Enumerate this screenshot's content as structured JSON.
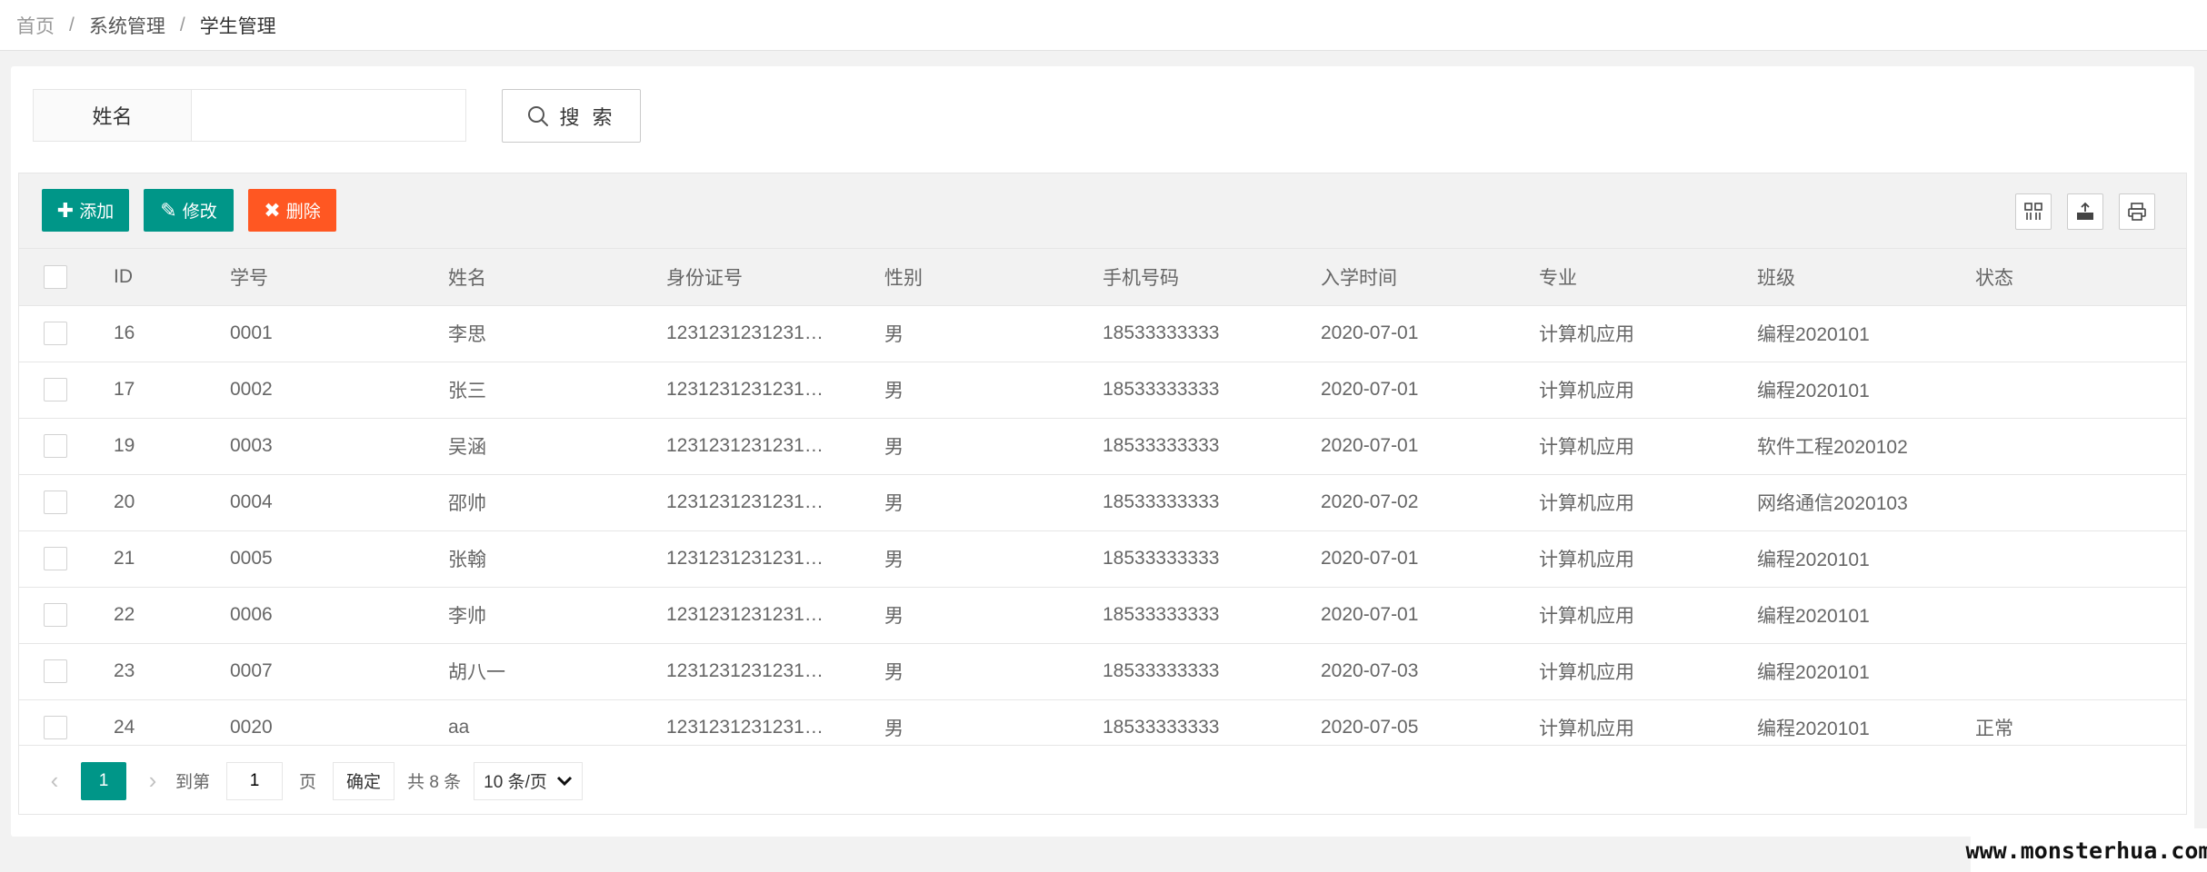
{
  "breadcrumb": {
    "home": "首页",
    "system": "系统管理",
    "current": "学生管理",
    "separator": "/"
  },
  "search": {
    "label": "姓名",
    "value": "",
    "placeholder": "",
    "button_label": "搜 索"
  },
  "toolbar": {
    "add_label": "添加",
    "edit_label": "修改",
    "delete_label": "删除"
  },
  "colors": {
    "primary": "#009688",
    "danger": "#ff5722"
  },
  "table": {
    "headers": [
      "ID",
      "学号",
      "姓名",
      "身份证号",
      "性别",
      "手机号码",
      "入学时间",
      "专业",
      "班级",
      "状态"
    ],
    "rows": [
      [
        "16",
        "0001",
        "李思",
        "1231231231231…",
        "男",
        "18533333333",
        "2020-07-01",
        "计算机应用",
        "编程2020101",
        ""
      ],
      [
        "17",
        "0002",
        "张三",
        "1231231231231…",
        "男",
        "18533333333",
        "2020-07-01",
        "计算机应用",
        "编程2020101",
        ""
      ],
      [
        "19",
        "0003",
        "吴涵",
        "1231231231231…",
        "男",
        "18533333333",
        "2020-07-01",
        "计算机应用",
        "软件工程2020102",
        ""
      ],
      [
        "20",
        "0004",
        "邵帅",
        "1231231231231…",
        "男",
        "18533333333",
        "2020-07-02",
        "计算机应用",
        "网络通信2020103",
        ""
      ],
      [
        "21",
        "0005",
        "张翰",
        "1231231231231…",
        "男",
        "18533333333",
        "2020-07-01",
        "计算机应用",
        "编程2020101",
        ""
      ],
      [
        "22",
        "0006",
        "李帅",
        "1231231231231…",
        "男",
        "18533333333",
        "2020-07-01",
        "计算机应用",
        "编程2020101",
        ""
      ],
      [
        "23",
        "0007",
        "胡八一",
        "1231231231231…",
        "男",
        "18533333333",
        "2020-07-03",
        "计算机应用",
        "编程2020101",
        ""
      ],
      [
        "24",
        "0020",
        "aa",
        "1231231231231…",
        "男",
        "18533333333",
        "2020-07-05",
        "计算机应用",
        "编程2020101",
        "正常"
      ]
    ]
  },
  "pager": {
    "current_page": "1",
    "goto_prefix": "到第",
    "goto_value": "1",
    "goto_suffix": "页",
    "confirm_label": "确定",
    "total_text": "共 8 条",
    "page_size": "10 条/页"
  },
  "watermark": "www.monsterhua.com"
}
